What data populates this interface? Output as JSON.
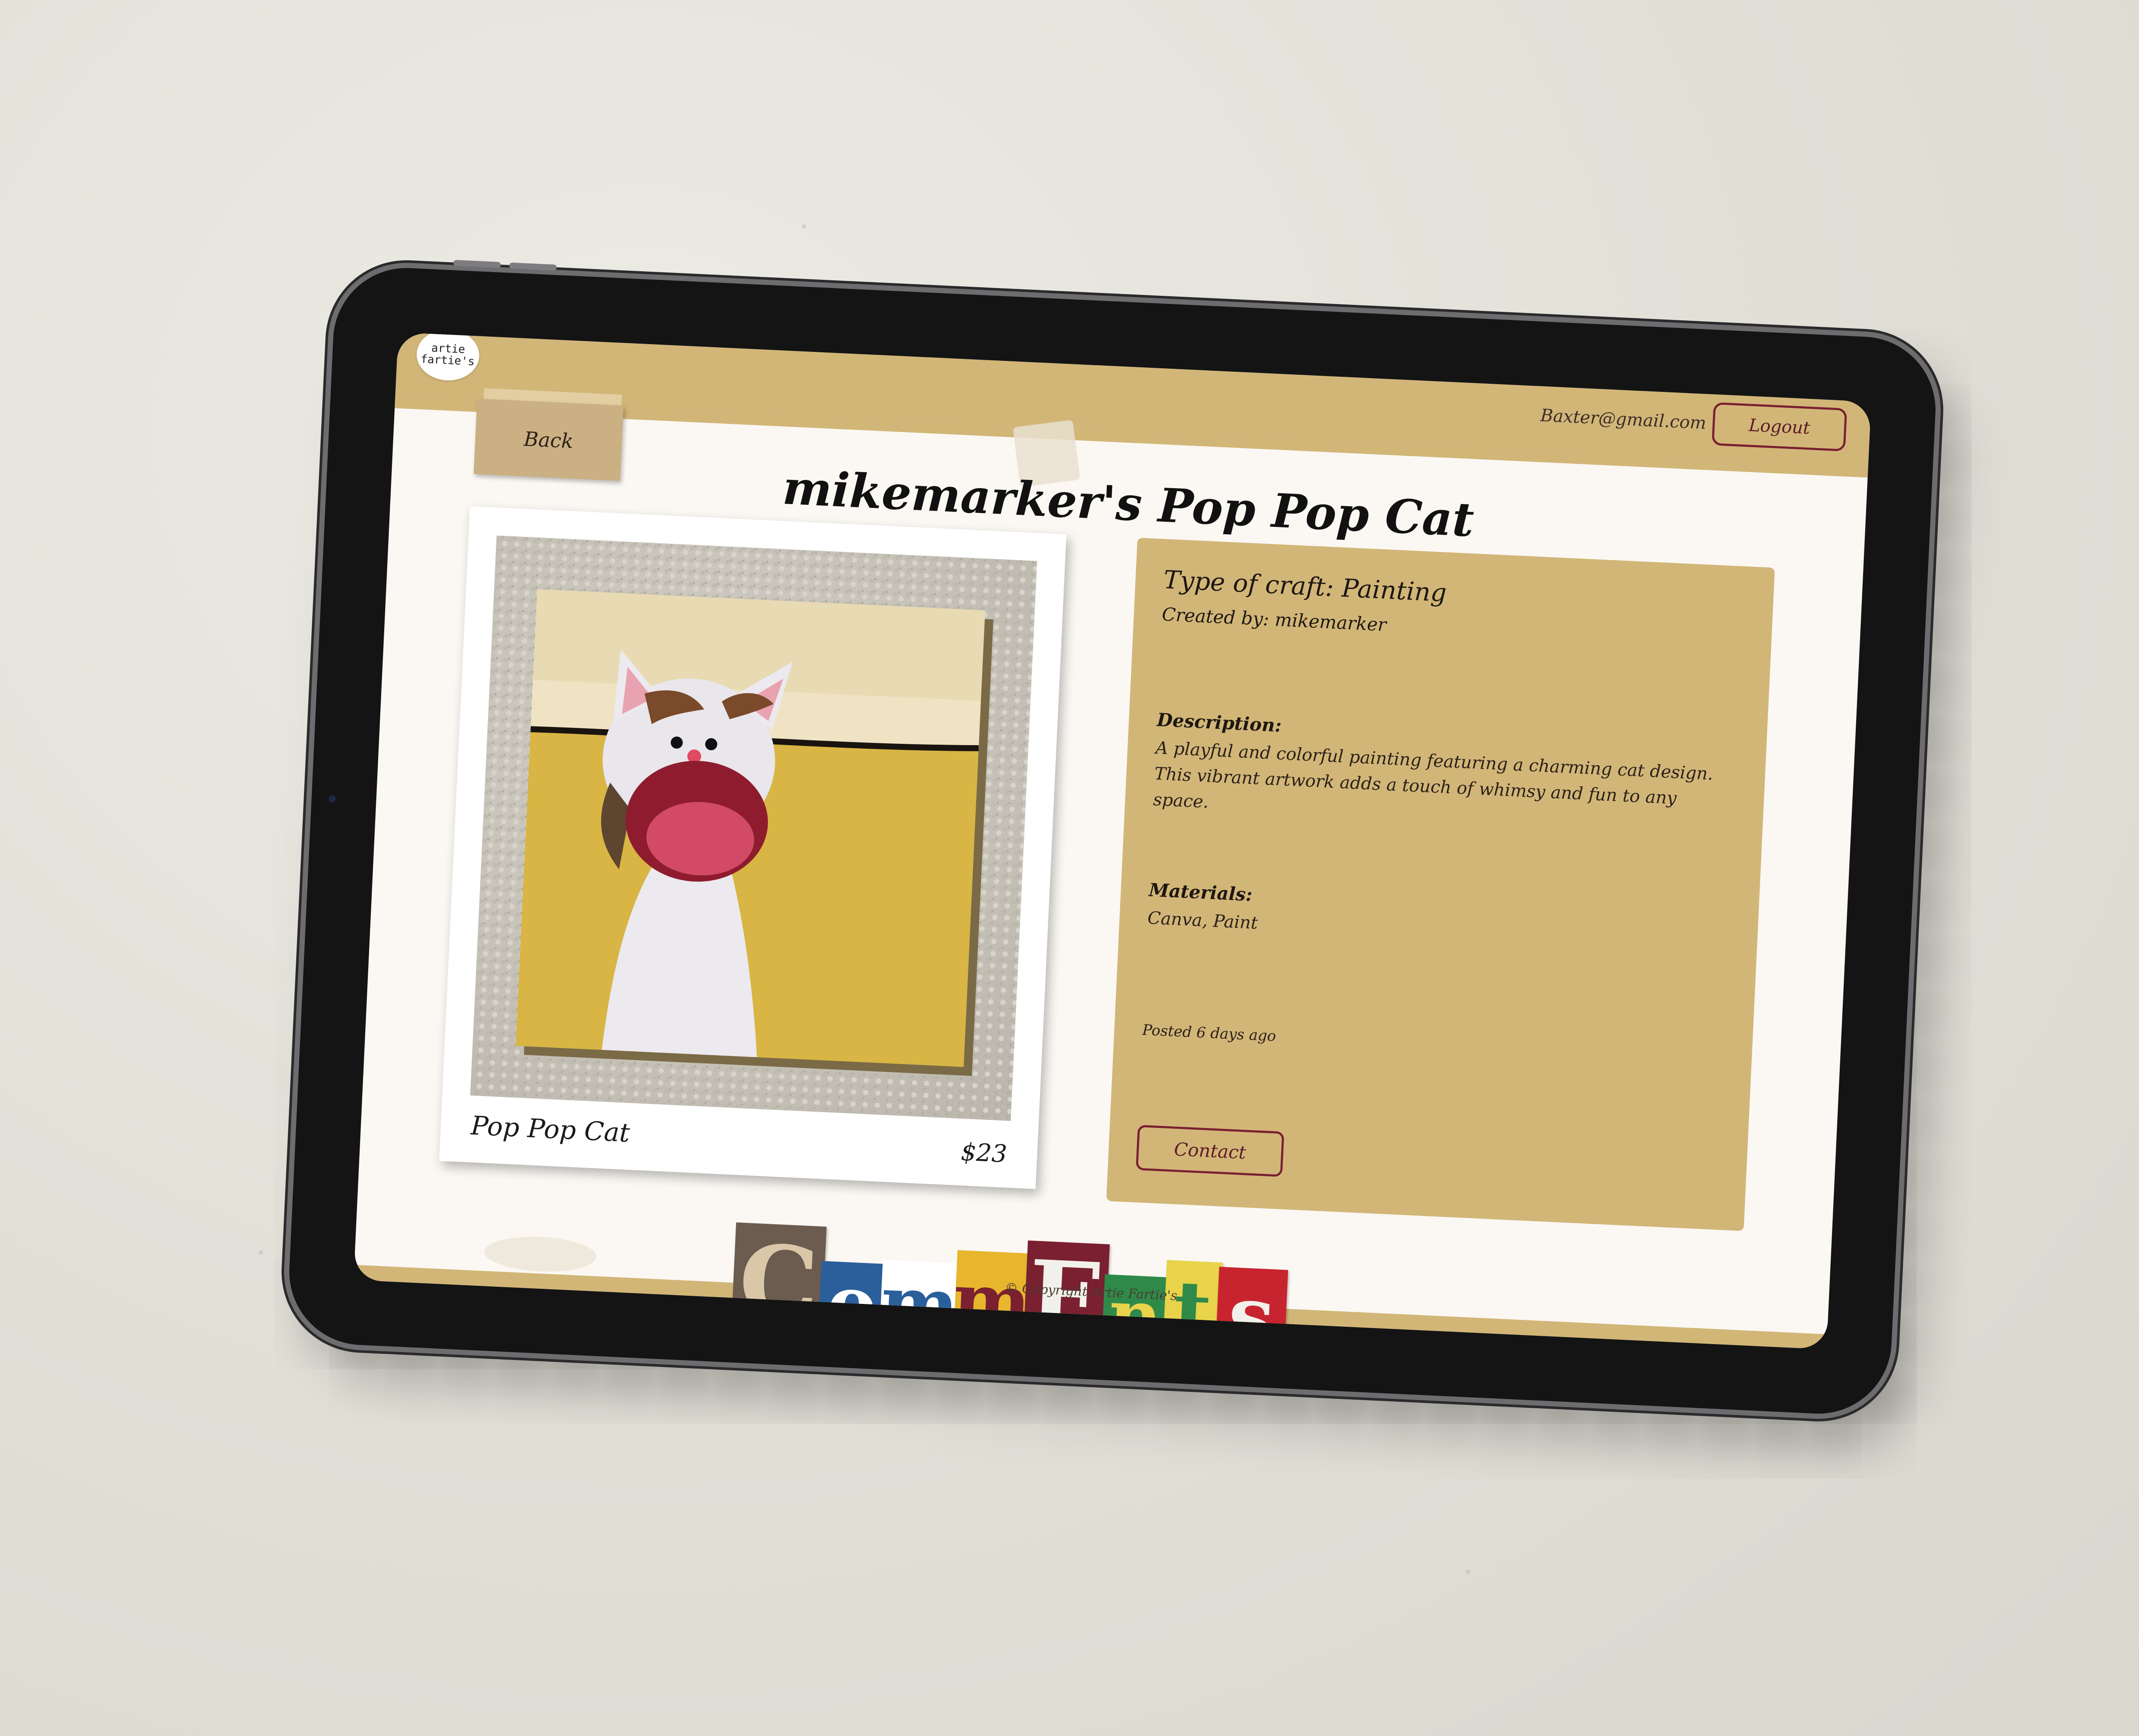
{
  "header": {
    "logo_text": "artie fartie's",
    "user_email": "Baxter@gmail.com",
    "logout_label": "Logout"
  },
  "nav": {
    "back_label": "Back"
  },
  "page": {
    "title": "mikemarker's Pop Pop Cat"
  },
  "listing": {
    "name": "Pop Pop Cat",
    "price": "$23",
    "craft_type": "Type of craft: Painting",
    "created_by": "Created by: mikemarker",
    "description_label": "Description:",
    "description": "A playful and colorful painting featuring a charming cat design. This vibrant artwork adds a touch of whimsy and fun to any space.",
    "materials_label": "Materials:",
    "materials": "Canva, Paint",
    "posted": "Posted 6 days ago",
    "contact_label": "Contact"
  },
  "comments": {
    "letters": [
      "C",
      "o",
      "m",
      "m",
      "E",
      "n",
      "t",
      "s"
    ],
    "colors": [
      "#6b5c4f",
      "#2a5f9c",
      "#e7b62c",
      "#7a2030",
      "#f2f0ea",
      "#2f8a4a",
      "#e8d34a",
      "#c8242f"
    ]
  },
  "footer": {
    "copyright": "© Copyright Artie Fartie's"
  }
}
